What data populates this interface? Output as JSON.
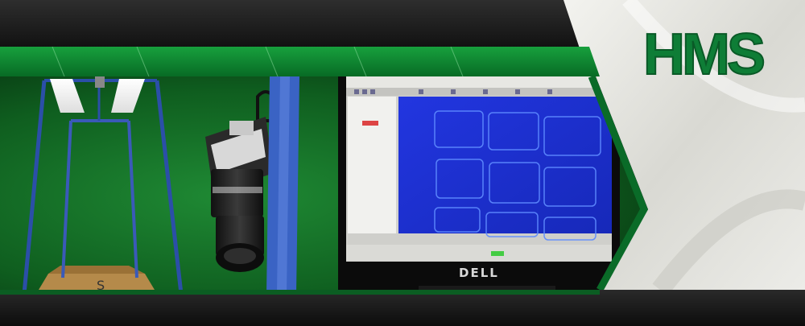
{
  "brand": {
    "logo_text": "HMS",
    "primary_green": "#0b7a2c",
    "logo_green": "#0e7d36",
    "dark_band": "#1c1c1c",
    "light_panel": "#e6e6e1"
  },
  "monitor": {
    "brand_label": "DELL",
    "screen_background": "#1f33d6",
    "window_chrome": "#dcdcd8"
  },
  "photo": {
    "background_green": "#16752a",
    "frame_color": "#2b4fa8"
  },
  "icons": [
    "monitor-icon",
    "camera-icon",
    "lamp-icon",
    "copy-stand-icon"
  ]
}
